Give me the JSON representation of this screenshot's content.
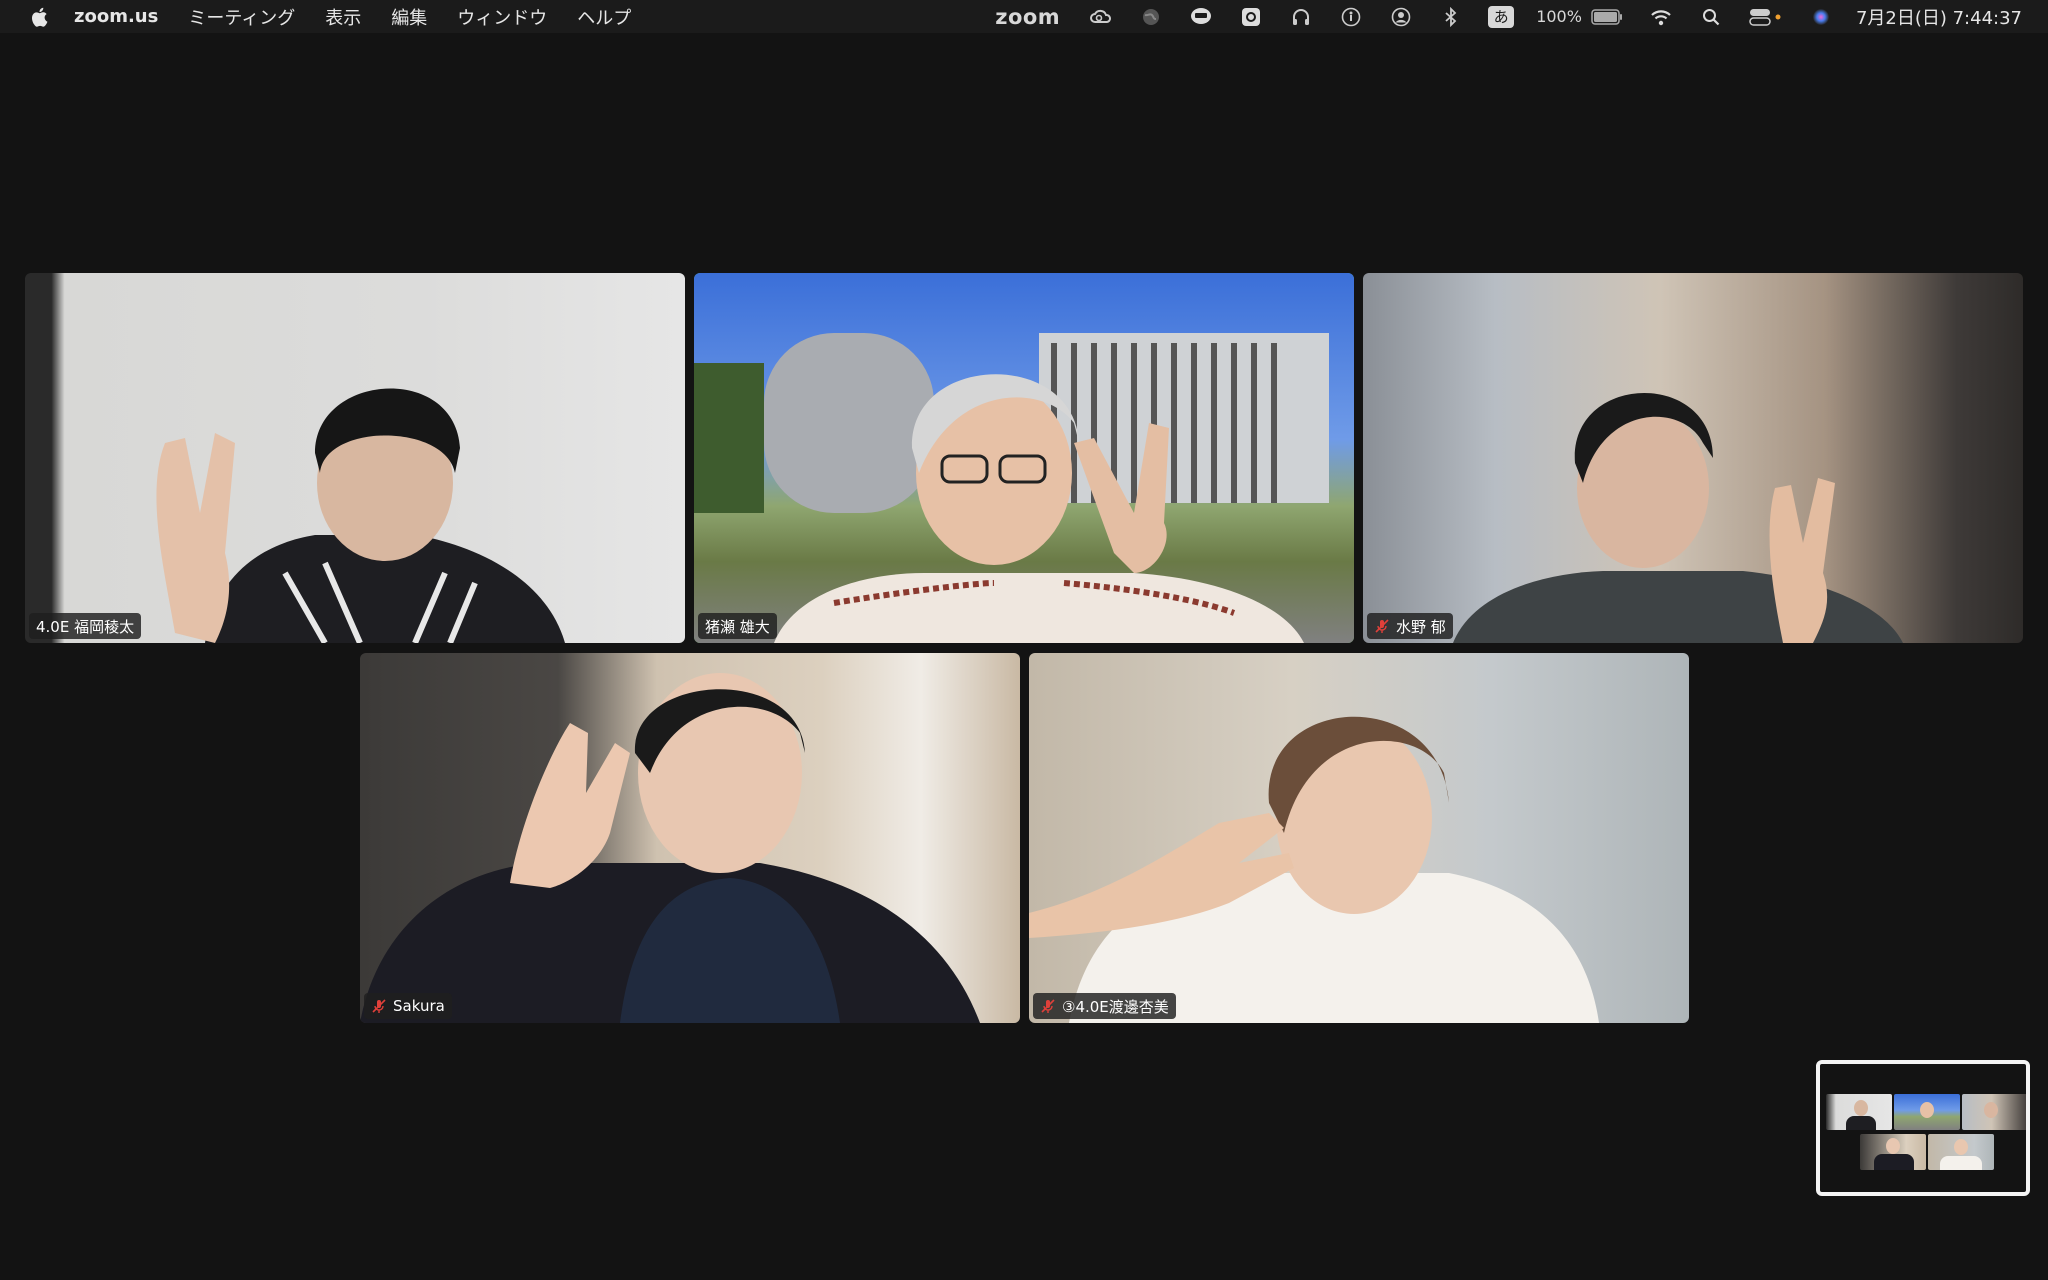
{
  "menubar": {
    "app_name": "zoom.us",
    "menus": [
      "ミーティング",
      "表示",
      "編集",
      "ウィンドウ",
      "ヘルプ"
    ],
    "status": {
      "zoom_word": "zoom",
      "ime": "あ",
      "battery": "100%",
      "clock": "7月2日(日)  7:44:37"
    }
  },
  "participants": [
    {
      "name": "4.0E 福岡稜太",
      "muted": false,
      "active": false
    },
    {
      "name": "猪瀬 雄大",
      "muted": false,
      "active": true
    },
    {
      "name": "水野 郁",
      "muted": true,
      "active": false
    },
    {
      "name": "Sakura",
      "muted": true,
      "active": false
    },
    {
      "name": "③4.0E渡邊杏美",
      "muted": true,
      "active": false
    }
  ],
  "colors": {
    "active_border": "#5ac85a",
    "mute_icon": "#e0403a",
    "background": "#131313"
  }
}
